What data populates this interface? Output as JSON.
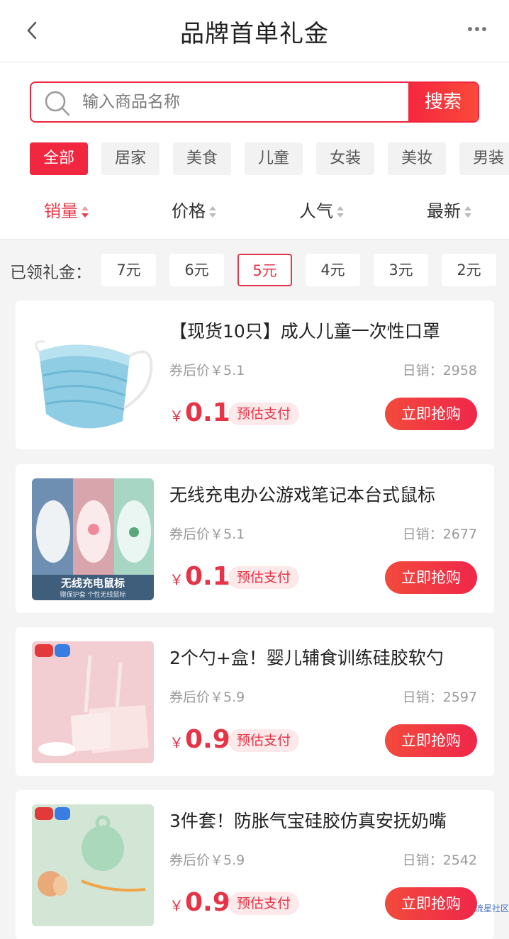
{
  "header": {
    "title": "品牌首单礼金"
  },
  "search": {
    "placeholder": "输入商品名称",
    "button": "搜索"
  },
  "categories": [
    "全部",
    "居家",
    "美食",
    "儿童",
    "女装",
    "美妆",
    "男装"
  ],
  "sorts": [
    "销量",
    "价格",
    "人气",
    "最新"
  ],
  "gift": {
    "label": "已领礼金：",
    "options": [
      "7元",
      "6元",
      "5元",
      "4元",
      "3元",
      "2元"
    ],
    "selected": "5元"
  },
  "products": [
    {
      "name": "【现货10只】成人儿童一次性口罩",
      "orig_price": "券后价￥5.1",
      "sales": "日销：2958",
      "price_symbol": "￥",
      "price": "0.1",
      "tag": "预估支付",
      "buy": "立即抢购",
      "image": "face-mask"
    },
    {
      "name": "无线充电办公游戏笔记本台式鼠标",
      "orig_price": "券后价￥5.1",
      "sales": "日销：2677",
      "price_symbol": "￥",
      "price": "0.1",
      "tag": "预估支付",
      "buy": "立即抢购",
      "image": "wireless-mouse",
      "image_caption": "无线充电鼠标",
      "image_subcaption": "赠保护套  个性无线鼠标"
    },
    {
      "name": "2个勺+盒！婴儿辅食训练硅胶软勺",
      "orig_price": "券后价￥5.9",
      "sales": "日销：2597",
      "price_symbol": "￥",
      "price": "0.9",
      "tag": "预估支付",
      "buy": "立即抢购",
      "image": "baby-spoon"
    },
    {
      "name": "3件套！防胀气宝硅胶仿真安抚奶嘴",
      "orig_price": "券后价￥5.9",
      "sales": "日销：2542",
      "price_symbol": "￥",
      "price": "0.9",
      "tag": "预估支付",
      "buy": "立即抢购",
      "image": "pacifier"
    }
  ],
  "watermark": "流星社区"
}
